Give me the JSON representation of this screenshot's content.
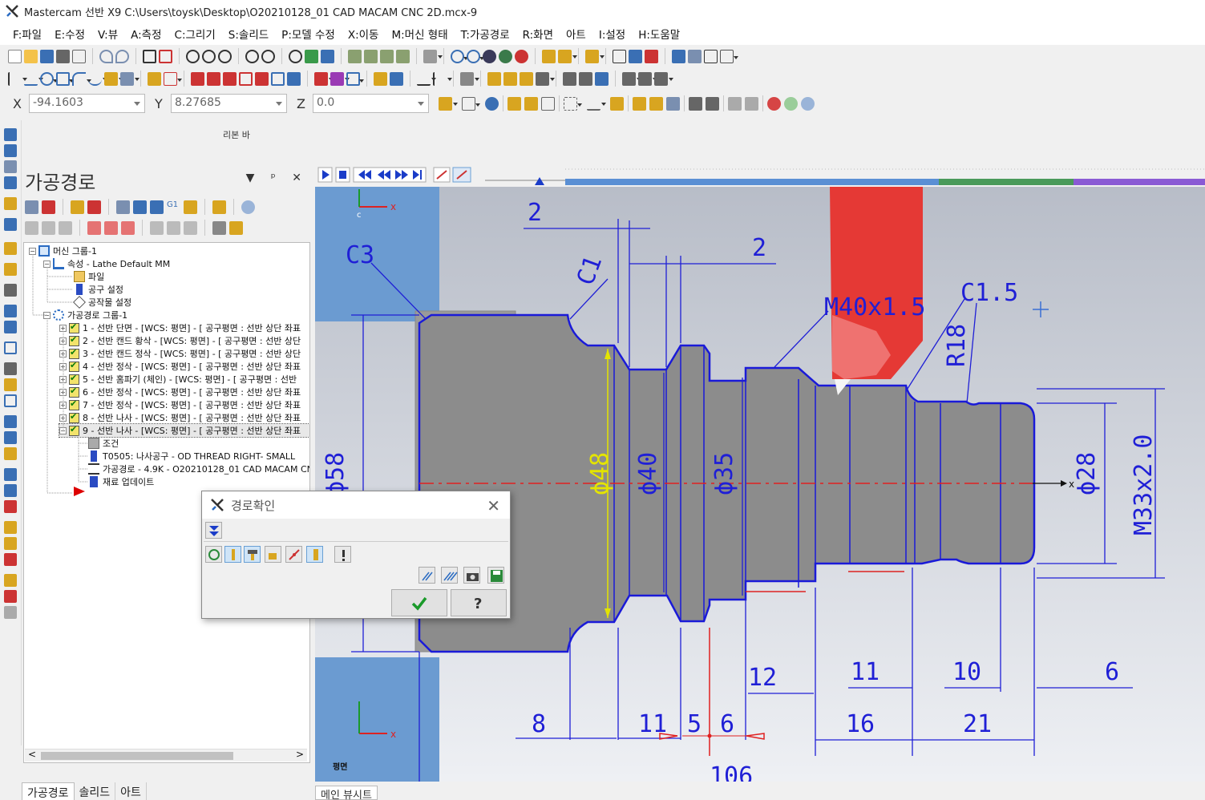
{
  "window": {
    "title": "Mastercam 선반 X9  C:\\Users\\toysk\\Desktop\\O20210128_01 CAD MACAM CNC 2D.mcx-9"
  },
  "menu": [
    "F:파일",
    "E:수정",
    "V:뷰",
    "A:측정",
    "C:그리기",
    "S:솔리드",
    "P:모델 수정",
    "X:이동",
    "M:머신 형태",
    "T:가공경로",
    "R:화면",
    "아트",
    "I:설정",
    "H:도움말"
  ],
  "coords": {
    "x_label": "X",
    "x_value": "-94.1603",
    "y_label": "Y",
    "y_value": "8.27685",
    "z_label": "Z",
    "z_value": "0.0"
  },
  "ribbon_label": "리본 바",
  "panel": {
    "title": "가공경로",
    "controls": "▼ ᵖ ✕",
    "tree": {
      "machine_group": "머신 그룹-1",
      "properties": "속성 - Lathe Default MM",
      "files": "파일",
      "tool_settings": "공구 설정",
      "stock_setup": "공작물 설정",
      "toolpath_group": "가공경로 그룹-1",
      "operations": [
        "1 - 선반 단면 - [WCS: 평면] - [ 공구평면 : 선반 상단 좌표",
        "2 - 선반 캔드 황삭 - [WCS: 평면] - [ 공구평면 : 선반 상단",
        "3 - 선반 캔드 정삭 - [WCS: 평면] - [ 공구평면 : 선반 상단",
        "4 - 선반 정삭 - [WCS: 평면] - [ 공구평면 : 선반 상단 좌표",
        "5 - 선반 홈파기 (체인) - [WCS: 평면] - [ 공구평면 : 선반",
        "6 - 선반 정삭 - [WCS: 평면] - [ 공구평면 : 선반 상단 좌표",
        "7 - 선반 정삭 - [WCS: 평면] - [ 공구평면 : 선반 상단 좌표",
        "8 - 선반 나사 - [WCS: 평면] - [ 공구평면 : 선반 상단 좌표",
        "9 - 선반 나사 - [WCS: 평면] - [ 공구평면 : 선반 상단 좌표"
      ],
      "op9_children": [
        "조건",
        "T0505: 나사공구 - OD THREAD RIGHT- SMALL",
        "가공경로 - 4.9K - O20210128_01 CAD MACAM CNC 2",
        "재료 업데이트"
      ]
    }
  },
  "bottom_tabs": [
    "가공경로",
    "솔리드",
    "아트"
  ],
  "viewport_tab": "메인 뷰시트",
  "viewport": {
    "plane_label": "평면",
    "axis_x": "x",
    "axis_c": "c",
    "dims": {
      "d2a": "2",
      "d2b": "2",
      "c3": "C3",
      "c1": "C1",
      "m40": "M40x1.5",
      "c15": "C1.5",
      "r18": "R18",
      "d48": "ϕ48",
      "d40": "ϕ40",
      "d35": "ϕ35",
      "d28": "ϕ28",
      "m33": "M33x2.0",
      "d58": "ϕ58",
      "l12": "12",
      "l11a": "11",
      "l10": "10",
      "l6a": "6",
      "l8": "8",
      "l11b": "11",
      "l5": "5",
      "l6b": "6",
      "l16": "16",
      "l21": "21",
      "l106": "106"
    }
  },
  "dialog": {
    "title": "경로확인"
  },
  "colors": {
    "dim_blue": "#1f1fd6",
    "stock_grey": "#909090",
    "tool_red": "#e53935",
    "bg_blue": "#6b9bd1"
  }
}
